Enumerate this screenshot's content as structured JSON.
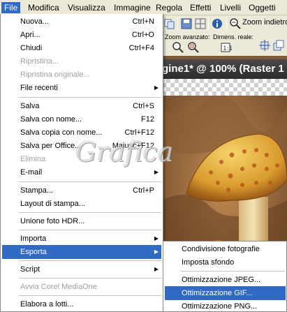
{
  "menubar": {
    "items": [
      "File",
      "Modifica",
      "Visualizza",
      "Immagine",
      "Regola",
      "Effetti",
      "Livelli",
      "Oggetti"
    ]
  },
  "toolbar": {
    "zoom_label": "Zoom indietro",
    "zoom_avanzato_label": "Zoom avanzato:",
    "dimens_reale_label": "Dimens. reale:"
  },
  "image_window": {
    "title": "gine1* @ 100% (Raster 1"
  },
  "file_menu": {
    "items": [
      {
        "label": "Nuova...",
        "shortcut": "Ctrl+N"
      },
      {
        "label": "Apri...",
        "shortcut": "Ctrl+O"
      },
      {
        "label": "Chiudi",
        "shortcut": "Ctrl+F4"
      },
      {
        "label": "Ripristina...",
        "shortcut": ""
      },
      {
        "label": "Ripristina originale...",
        "shortcut": ""
      },
      {
        "label": "File recenti",
        "shortcut": ""
      },
      {
        "label": "Salva",
        "shortcut": "Ctrl+S"
      },
      {
        "label": "Salva con nome...",
        "shortcut": "F12"
      },
      {
        "label": "Salva copia con nome...",
        "shortcut": "Ctrl+F12"
      },
      {
        "label": "Salva per Office...",
        "shortcut": "Maiusc+F12"
      },
      {
        "label": "Elimina",
        "shortcut": ""
      },
      {
        "label": "E-mail",
        "shortcut": ""
      },
      {
        "label": "Stampa...",
        "shortcut": "Ctrl+P"
      },
      {
        "label": "Layout di stampa...",
        "shortcut": ""
      },
      {
        "label": "Unione foto HDR...",
        "shortcut": ""
      },
      {
        "label": "Importa",
        "shortcut": ""
      },
      {
        "label": "Esporta",
        "shortcut": ""
      },
      {
        "label": "Script",
        "shortcut": ""
      },
      {
        "label": "Avvia Corel MediaOne",
        "shortcut": ""
      },
      {
        "label": "Elabora a lotti...",
        "shortcut": ""
      }
    ]
  },
  "export_submenu": {
    "items": [
      {
        "label": "Condivisione fotografie"
      },
      {
        "label": "Imposta sfondo"
      },
      {
        "label": "Ottimizzazione JPEG..."
      },
      {
        "label": "Ottimizzazione GIF..."
      },
      {
        "label": "Ottimizzazione PNG..."
      }
    ]
  },
  "watermark": {
    "text": "Grafica"
  },
  "colors": {
    "highlight": "#316ac5",
    "menu_bg": "#ffffff",
    "chrome_bg": "#ece9d8",
    "disabled_text": "#a0a0a0"
  }
}
